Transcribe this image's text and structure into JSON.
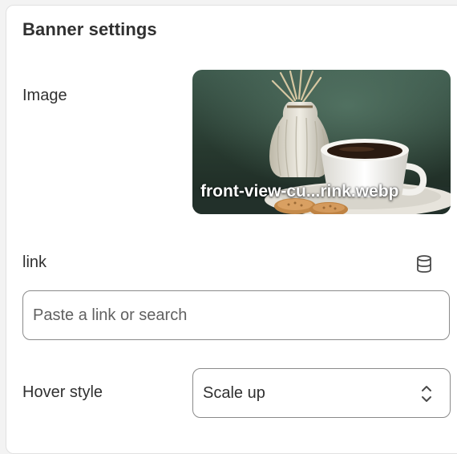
{
  "section": {
    "title": "Banner settings"
  },
  "image_setting": {
    "label": "Image",
    "filename": "front-view-cu...rink.webp"
  },
  "link_setting": {
    "label": "link",
    "placeholder": "Paste a link or search",
    "value": "",
    "icon": "database-icon"
  },
  "hover_setting": {
    "label": "Hover style",
    "selected": "Scale up",
    "icon": "chevron-up-down-icon"
  },
  "colors": {
    "text": "#303030",
    "border": "#8a8a8a",
    "panel_border": "#e1e1e1",
    "caption": "#ffffff"
  }
}
